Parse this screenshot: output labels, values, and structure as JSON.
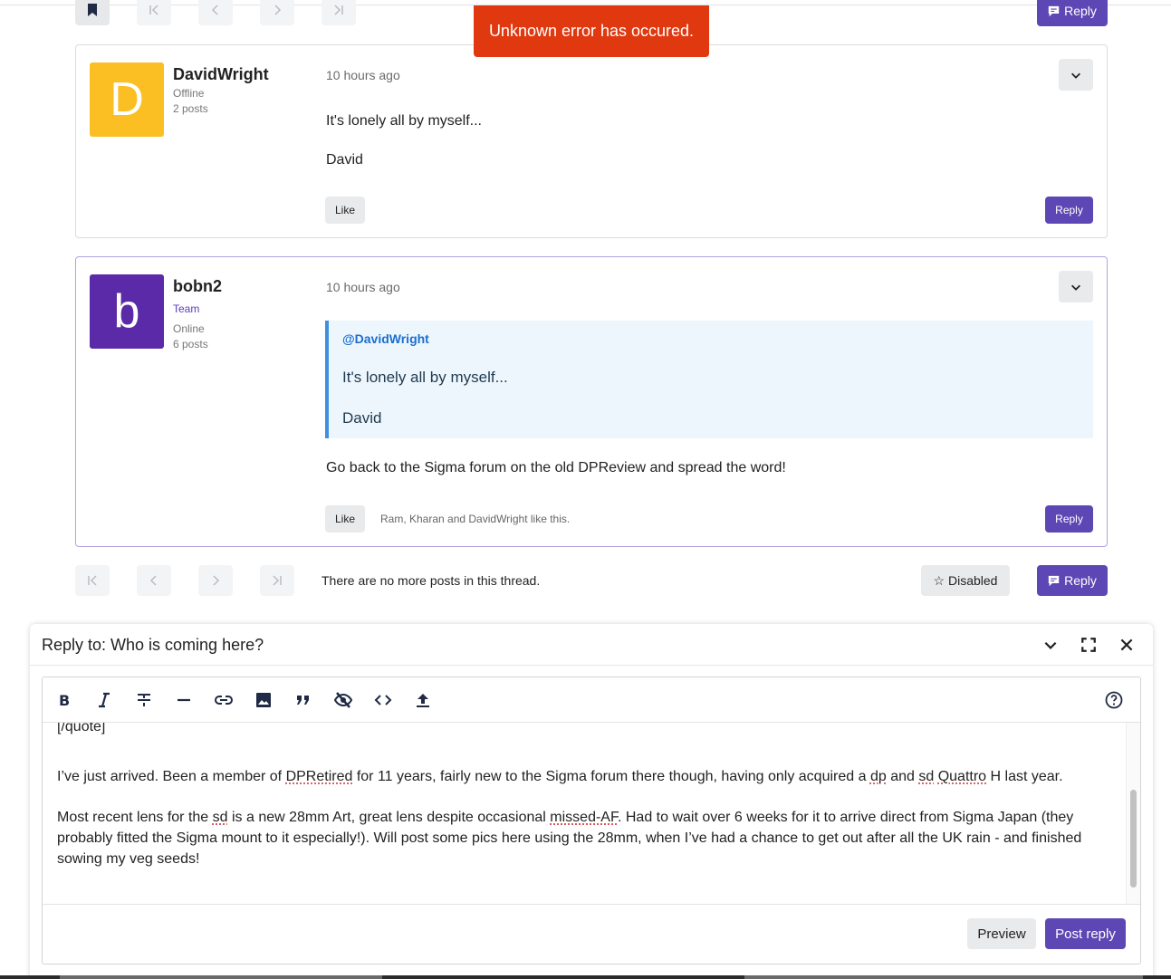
{
  "toast": {
    "message": "Unknown error has occured."
  },
  "top_bar": {
    "reply_label": "Reply"
  },
  "posts": [
    {
      "author": "DavidWright",
      "avatar_letter": "D",
      "avatar_color": "#fbbf24",
      "status": "Offline",
      "post_count": "2 posts",
      "time": "10 hours ago",
      "lines": [
        "It's lonely all by myself...",
        "David"
      ],
      "like_label": "Like",
      "reply_label": "Reply"
    },
    {
      "author": "bobn2",
      "avatar_letter": "b",
      "avatar_color": "#5b2aa8",
      "role": "Team",
      "status": "Online",
      "post_count": "6 posts",
      "time": "10 hours ago",
      "quote": {
        "author": "@DavidWright",
        "lines": [
          "It's lonely all by myself...",
          "David"
        ]
      },
      "body": "Go back to the Sigma forum on the old DPReview and spread the word!",
      "like_label": "Like",
      "likes_text": "Ram, Kharan and DavidWright like this.",
      "reply_label": "Reply"
    }
  ],
  "thread_footer": {
    "message": "There are no more posts in this thread.",
    "disabled_label": "☆ Disabled",
    "reply_label": "Reply"
  },
  "composer": {
    "title": "Reply to: Who is coming here?",
    "cut_line": "[/quote]",
    "para1": {
      "a": "I’ve just arrived. Been a member of ",
      "b": "DPRetired",
      "c": " for 11 years, fairly new to the Sigma forum there though, having only acquired a ",
      "d": "dp",
      "e": " and ",
      "f": "sd",
      "g": " ",
      "h": "Quattro",
      "i": " H last year."
    },
    "para2": {
      "a": "Most recent lens for the ",
      "b": "sd",
      "c": " is a new 28mm Art, great lens despite occasional ",
      "d": "missed-AF",
      "e": ". Had to wait over 6 weeks for it to arrive direct from Sigma Japan (they probably fitted the Sigma mount to it especially!). Will post some pics here using the 28mm, when I’ve had a chance to get out after all the UK rain - and finished sowing my veg seeds!"
    },
    "preview_label": "Preview",
    "post_label": "Post reply",
    "toolbar_icons": [
      "bold-icon",
      "italic-icon",
      "strikethrough-icon",
      "horizontal-rule-icon",
      "link-icon",
      "image-icon",
      "quote-icon",
      "spoiler-icon",
      "code-icon",
      "upload-icon",
      "help-icon"
    ]
  },
  "colors": {
    "primary": "#5d47b4",
    "toast": "#e0380f",
    "quote_border": "#3d8fe0",
    "quote_bg": "#eef6fd",
    "team": "#5d3bb8"
  }
}
